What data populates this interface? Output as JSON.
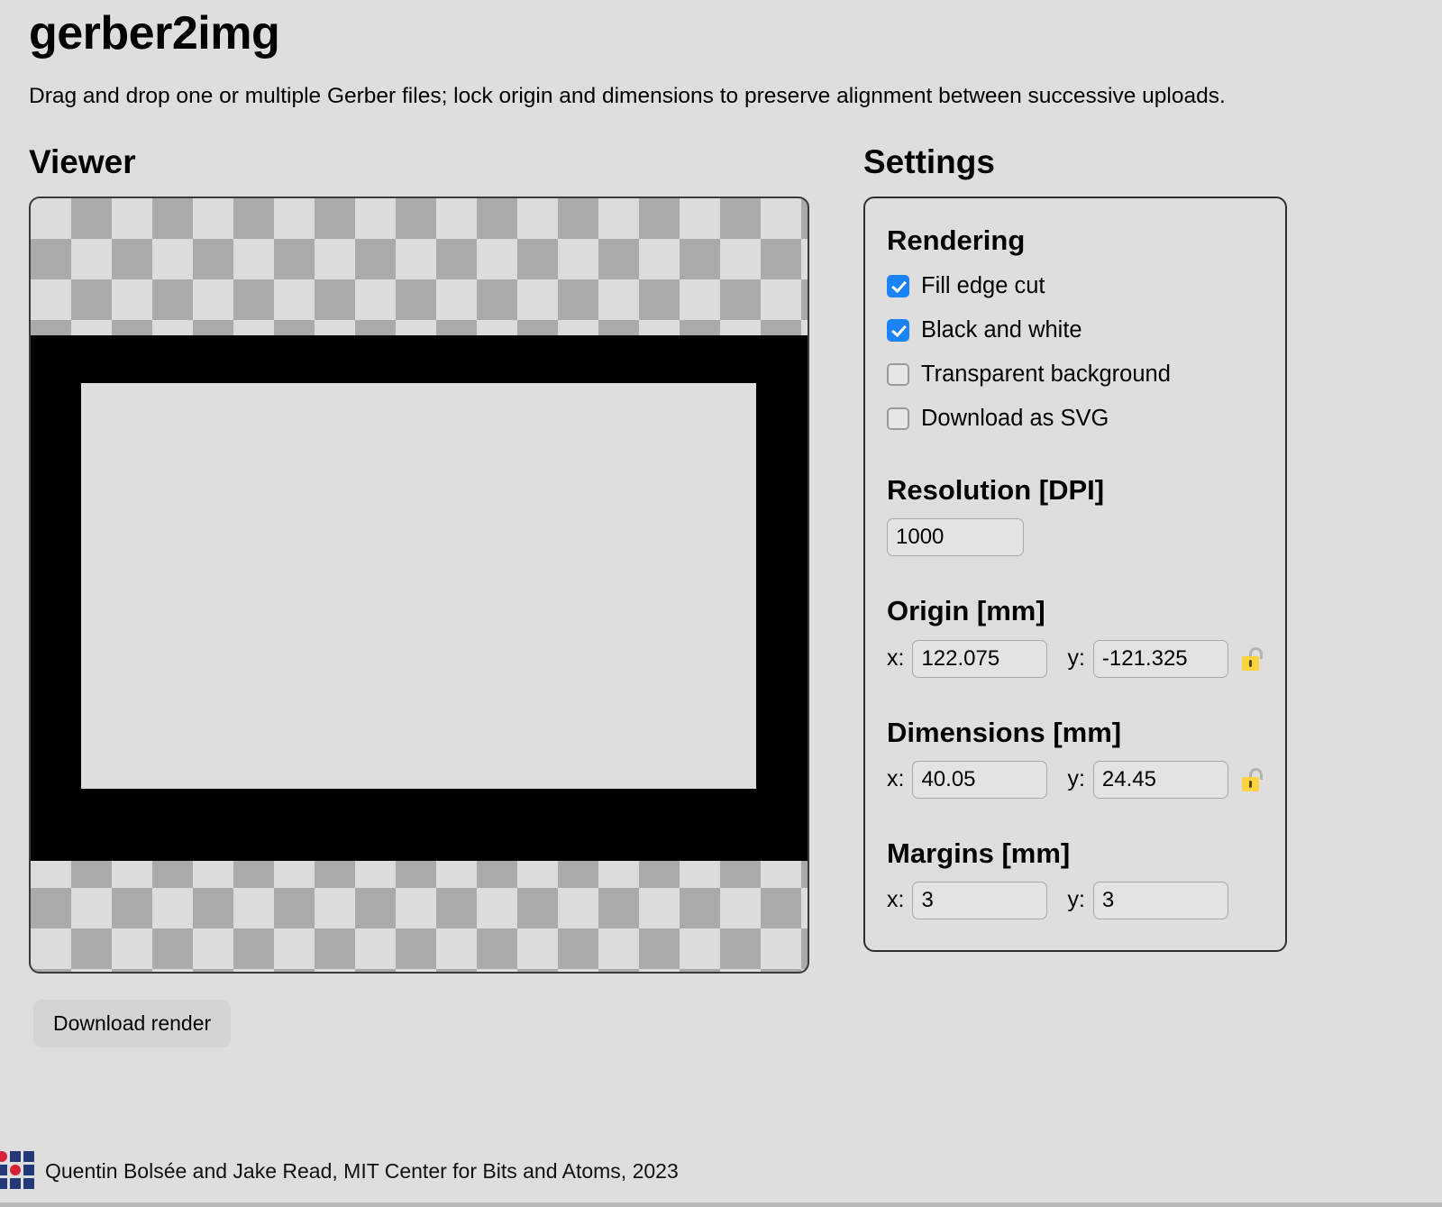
{
  "header": {
    "title": "gerber2img",
    "subtitle": "Drag and drop one or multiple Gerber files; lock origin and dimensions to preserve alignment between successive uploads."
  },
  "viewer": {
    "heading": "Viewer",
    "download_label": "Download render"
  },
  "settings": {
    "heading": "Settings",
    "rendering": {
      "heading": "Rendering",
      "options": [
        {
          "label": "Fill edge cut",
          "checked": true
        },
        {
          "label": "Black and white",
          "checked": true
        },
        {
          "label": "Transparent background",
          "checked": false
        },
        {
          "label": "Download as SVG",
          "checked": false
        }
      ]
    },
    "resolution": {
      "heading": "Resolution [DPI]",
      "value": "1000"
    },
    "origin": {
      "heading": "Origin [mm]",
      "x_label": "x:",
      "x_value": "122.075",
      "y_label": "y:",
      "y_value": "-121.325",
      "lock_state": "unlocked"
    },
    "dimensions": {
      "heading": "Dimensions [mm]",
      "x_label": "x:",
      "x_value": "40.05",
      "y_label": "y:",
      "y_value": "24.45",
      "lock_state": "unlocked"
    },
    "margins": {
      "heading": "Margins [mm]",
      "x_label": "x:",
      "x_value": "3",
      "y_label": "y:",
      "y_value": "3"
    }
  },
  "footer": {
    "credit": "Quentin Bolsée and Jake Read, MIT Center for Bits and Atoms, 2023"
  },
  "colors": {
    "page_background": "#dedede",
    "checkbox_accent": "#1a83fb",
    "lock_body": "#fcd341",
    "logo_blue": "#24387a",
    "logo_red": "#d81f35",
    "render_stroke": "#000000"
  }
}
